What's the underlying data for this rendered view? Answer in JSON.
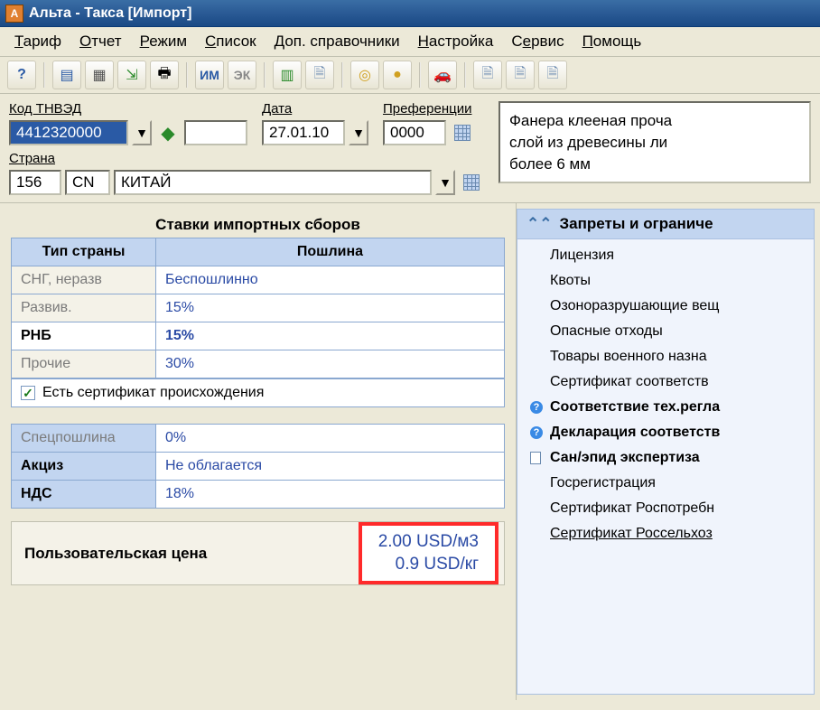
{
  "window": {
    "title": "Альта - Такса [Импорт]"
  },
  "menu": {
    "items": [
      {
        "pre": "",
        "u": "Т",
        "post": "ариф"
      },
      {
        "pre": "",
        "u": "О",
        "post": "тчет"
      },
      {
        "pre": "",
        "u": "Р",
        "post": "ежим"
      },
      {
        "pre": "",
        "u": "С",
        "post": "писок"
      },
      {
        "pre": "",
        "u": "Д",
        "post": "оп. справочники"
      },
      {
        "pre": "",
        "u": "Н",
        "post": "астройка"
      },
      {
        "pre": "С",
        "u": "е",
        "post": "рвис"
      },
      {
        "pre": "",
        "u": "П",
        "post": "омощь"
      }
    ]
  },
  "toolbar": {
    "im": "ИМ",
    "ek": "ЭК"
  },
  "form": {
    "tnved_label": "Код ТНВЭД",
    "tnved": "4412320000",
    "date_label": "Дата",
    "date": "27.01.10",
    "pref_label": "Преференции",
    "pref": "0000",
    "country_label": "Страна",
    "country_code": "156",
    "country_iso": "CN",
    "country_name": "КИТАЙ",
    "description": "Фанера клееная проча\nслой из древесины ли\nболее 6 мм"
  },
  "rates": {
    "title": "Ставки импортных сборов",
    "headers": {
      "type": "Тип страны",
      "duty": "Пошлина"
    },
    "rows": [
      {
        "type": "СНГ, неразв",
        "duty": "Беспошлинно",
        "active": false
      },
      {
        "type": "Развив.",
        "duty": "15%",
        "active": false
      },
      {
        "type": "РНБ",
        "duty": "15%",
        "active": true
      },
      {
        "type": "Прочие",
        "duty": "30%",
        "active": false
      }
    ],
    "cert_label": "Есть сертификат происхождения",
    "cert_checked": "✓"
  },
  "extra": {
    "rows": [
      {
        "type": "Спецпошлина",
        "val": "0%",
        "active": false
      },
      {
        "type": "Акциз",
        "val": "Не облагается",
        "active": true
      },
      {
        "type": "НДС",
        "val": "18%",
        "active": true
      }
    ]
  },
  "user_price": {
    "label": "Пользовательская цена",
    "line1": "2.00 USD/м3",
    "line2": "0.9 USD/кг"
  },
  "restrictions": {
    "title": "Запреты и ограниче",
    "items": [
      {
        "text": "Лицензия",
        "bold": false,
        "icon": ""
      },
      {
        "text": "Квоты",
        "bold": false,
        "icon": ""
      },
      {
        "text": "Озоноразрушающие вещ",
        "bold": false,
        "icon": ""
      },
      {
        "text": "Опасные отходы",
        "bold": false,
        "icon": ""
      },
      {
        "text": "Товары военного назна",
        "bold": false,
        "icon": ""
      },
      {
        "text": "Сертификат соответств",
        "bold": false,
        "icon": ""
      },
      {
        "text": "Соответствие тех.регла",
        "bold": true,
        "icon": "help"
      },
      {
        "text": "Декларация соответств",
        "bold": true,
        "icon": "help"
      },
      {
        "text": "Сан/эпид экспертиза",
        "bold": true,
        "icon": "doc"
      },
      {
        "text": "Госрегистрация",
        "bold": false,
        "icon": ""
      },
      {
        "text": "Сертификат Роспотребн",
        "bold": false,
        "icon": ""
      },
      {
        "text": "Сертификат Россельхоз",
        "bold": false,
        "icon": "",
        "link": true
      }
    ]
  }
}
